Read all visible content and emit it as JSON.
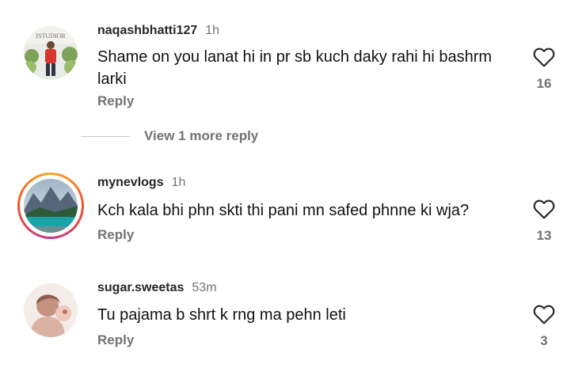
{
  "comments": [
    {
      "username": "naqashbhatti127",
      "time": "1h",
      "text": "Shame on you lanat hi in pr sb kuch daky rahi hi bashrm larki",
      "reply_label": "Reply",
      "likes": "16",
      "avatar_text": "ISTUDIOR"
    },
    {
      "username": "mynevlogs",
      "time": "1h",
      "text": "Kch kala bhi phn skti thi pani mn safed phnne ki wja?",
      "reply_label": "Reply",
      "likes": "13"
    },
    {
      "username": "sugar.sweetas",
      "time": "53m",
      "text": "Tu pajama b shrt k rng ma pehn leti",
      "reply_label": "Reply",
      "likes": "3"
    }
  ],
  "view_more_replies": "View 1 more reply",
  "colors": {
    "secondary_text": "#737373",
    "story_ring": [
      "#f9a825",
      "#f2542d",
      "#c1358a"
    ]
  }
}
